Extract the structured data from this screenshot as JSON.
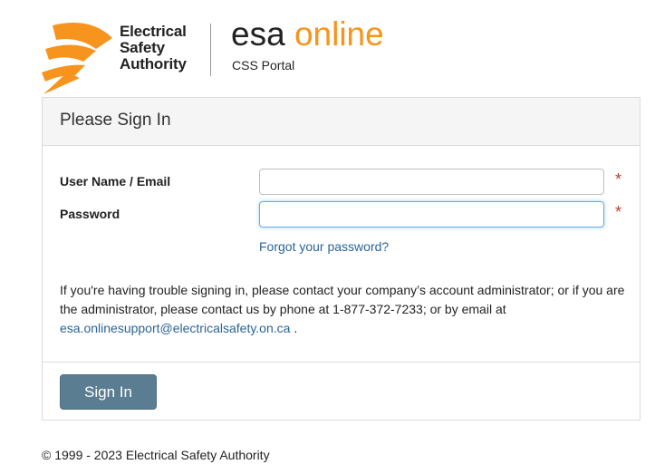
{
  "header": {
    "logo_lines": [
      "Electrical",
      "Safety",
      "Authority"
    ],
    "brand_main": "esa",
    "brand_accent": "online",
    "subtitle": "CSS Portal",
    "accent_color": "#f7941d"
  },
  "signin": {
    "title": "Please Sign In",
    "username_label": "User Name / Email",
    "username_value": "",
    "password_label": "Password",
    "password_value": "",
    "required_marker": "*",
    "forgot_link": "Forgot your password?",
    "help_text": "If you're having trouble signing in, please contact your company’s account administrator; or if you are the administrator, please contact us by phone at 1-877-372-7233; or by email at",
    "help_email": "esa.onlinesupport@electricalsafety.on.ca",
    "help_end": " .",
    "button_label": "Sign In"
  },
  "footer": {
    "copyright": "© 1999 - 2023 Electrical Safety Authority"
  },
  "icons": [
    "esa-logo-icon"
  ]
}
